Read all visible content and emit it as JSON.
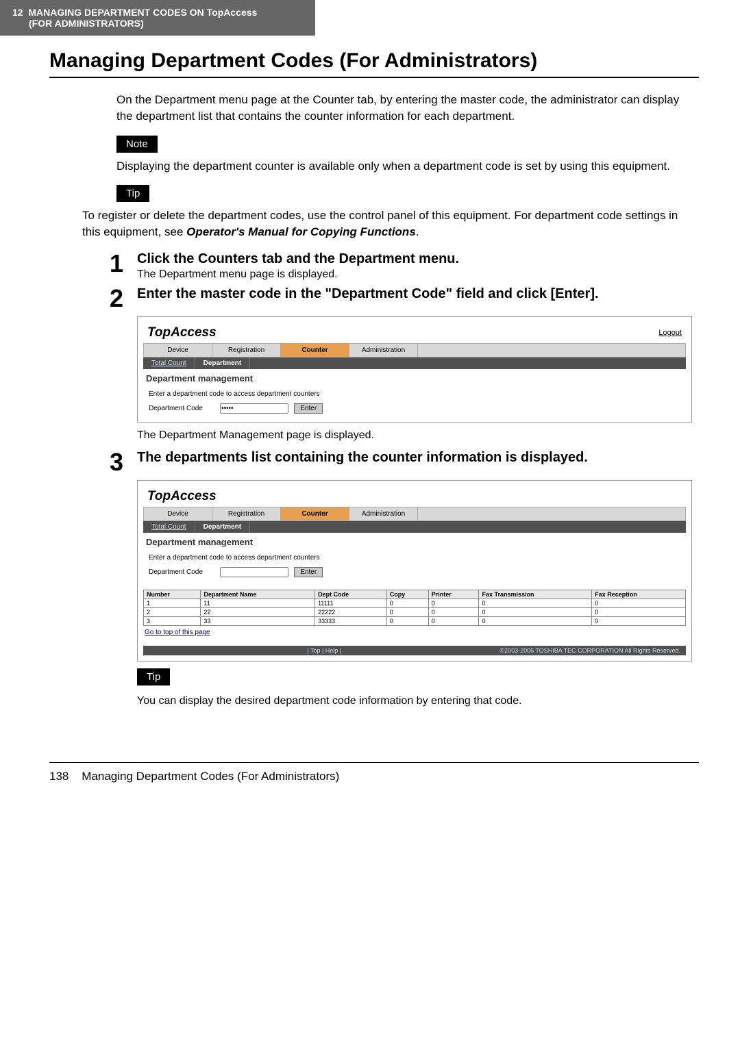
{
  "chapter": {
    "num": "12",
    "title_line1": "MANAGING DEPARTMENT CODES ON TopAccess",
    "title_line2": "(FOR ADMINISTRATORS)"
  },
  "section_title": "Managing Department Codes (For Administrators)",
  "intro": "On the Department menu page at the Counter tab, by entering the master code, the administrator can display the department list that contains the counter information for each department.",
  "note_label": "Note",
  "note_body": "Displaying the department counter is available only when a department code is set by using this equipment.",
  "tip_label": "Tip",
  "tip_body_1a": "To register or delete the department codes, use the control panel of this equipment. For department code settings in this equipment, see ",
  "tip_body_1b": "Operator's Manual for Copying Functions",
  "tip_body_1c": ".",
  "steps": {
    "s1": {
      "num": "1",
      "heading": "Click the Counters tab and the Department menu.",
      "sub": "The Department menu page is displayed."
    },
    "s2": {
      "num": "2",
      "heading": "Enter the master code in the \"Department Code\" field and click [Enter]."
    },
    "s2_after": "The Department Management page is displayed.",
    "s3": {
      "num": "3",
      "heading": "The departments list containing the counter information is displayed."
    }
  },
  "shot": {
    "brand": "TopAccess",
    "logout": "Logout",
    "tabs": {
      "device": "Device",
      "registration": "Registration",
      "counter": "Counter",
      "admin": "Administration"
    },
    "subtabs": {
      "total": "Total Count",
      "dept": "Department"
    },
    "panel_title": "Department management",
    "instruction": "Enter a department code to access department counters",
    "field_label": "Department Code",
    "masked": "•••••",
    "enter": "Enter",
    "goto_top": "Go to top of this page",
    "footer_center": "| Top | Help |",
    "footer_right": "©2003-2006 TOSHIBA TEC CORPORATION All Rights Reserved."
  },
  "chart_data": {
    "type": "table",
    "columns": [
      "Number",
      "Department Name",
      "Dept Code",
      "Copy",
      "Printer",
      "Fax Transmission",
      "Fax Reception"
    ],
    "rows": [
      [
        "1",
        "11",
        "11111",
        "0",
        "0",
        "0",
        "0"
      ],
      [
        "2",
        "22",
        "22222",
        "0",
        "0",
        "0",
        "0"
      ],
      [
        "3",
        "33",
        "33333",
        "0",
        "0",
        "0",
        "0"
      ]
    ]
  },
  "tip2_body": "You can display the desired department code information by entering that code.",
  "page_footer": {
    "num": "138",
    "title": "Managing Department Codes (For Administrators)"
  }
}
